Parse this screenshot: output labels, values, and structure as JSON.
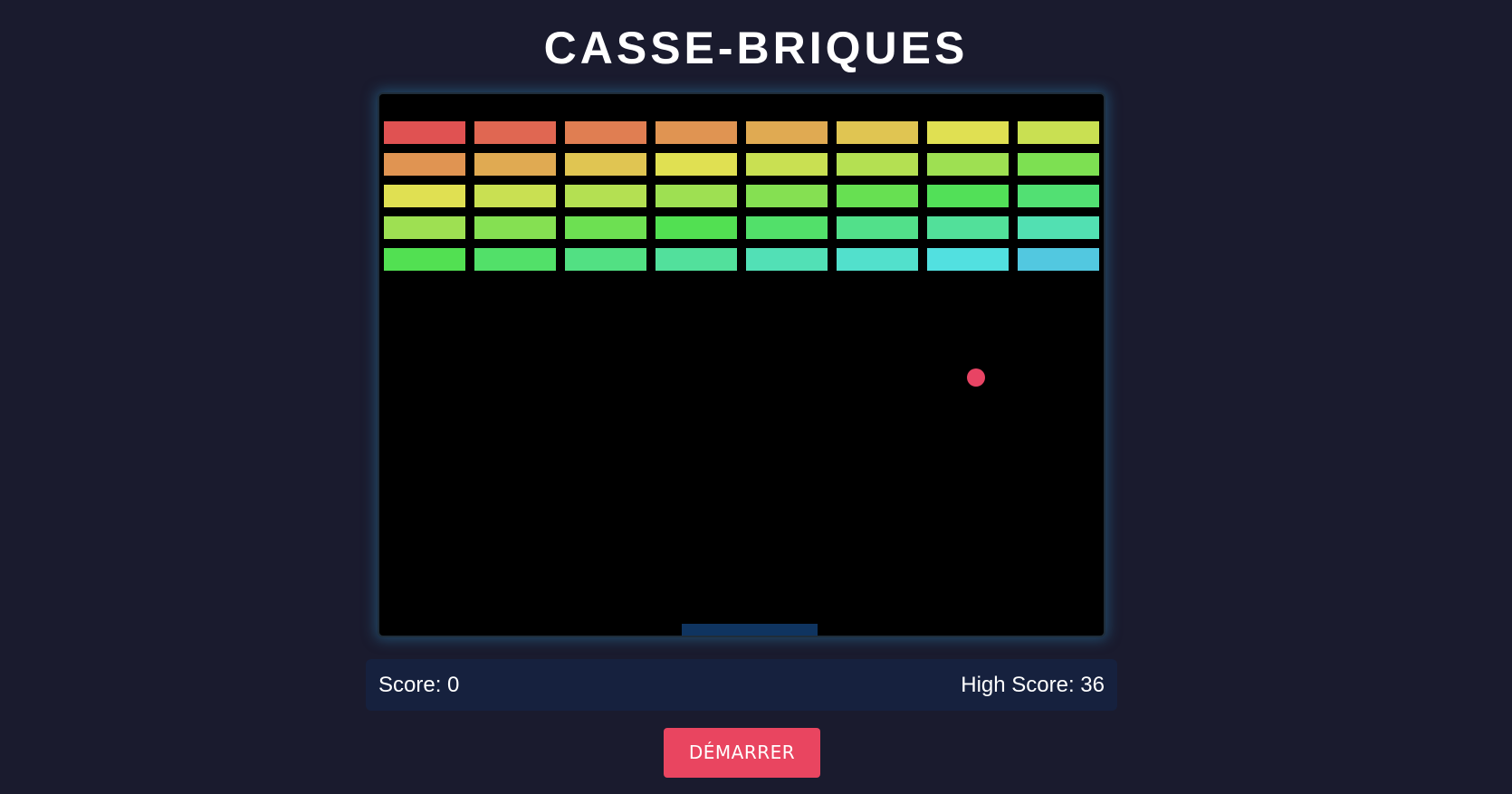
{
  "title": "CASSE-BRIQUES",
  "game": {
    "brick_rows": [
      [
        "#e05252",
        "#e06752",
        "#e07e52",
        "#e09452",
        "#e0aa52",
        "#e0c552",
        "#e0e052",
        "#c9e052"
      ],
      [
        "#e09452",
        "#e0aa52",
        "#e0c552",
        "#e0e052",
        "#c9e052",
        "#b4e052",
        "#9ee052",
        "#7de052"
      ],
      [
        "#e0e052",
        "#c9e052",
        "#b4e052",
        "#9ee052",
        "#85e052",
        "#67e052",
        "#52e058",
        "#52e073"
      ],
      [
        "#9ee052",
        "#85e052",
        "#6de052",
        "#52e052",
        "#52e06a",
        "#52e08a",
        "#52e09a",
        "#52e0b2"
      ],
      [
        "#52e052",
        "#52e069",
        "#52e083",
        "#52e09c",
        "#52e0b6",
        "#52e0cc",
        "#52e0e0",
        "#52c8e0"
      ]
    ],
    "ball_color": "#e84464",
    "paddle_color": "#0f3460"
  },
  "scoreboard": {
    "score": "Score: 0",
    "high_score": "High Score: 36"
  },
  "start_button": {
    "label": "DÉMARRER"
  }
}
